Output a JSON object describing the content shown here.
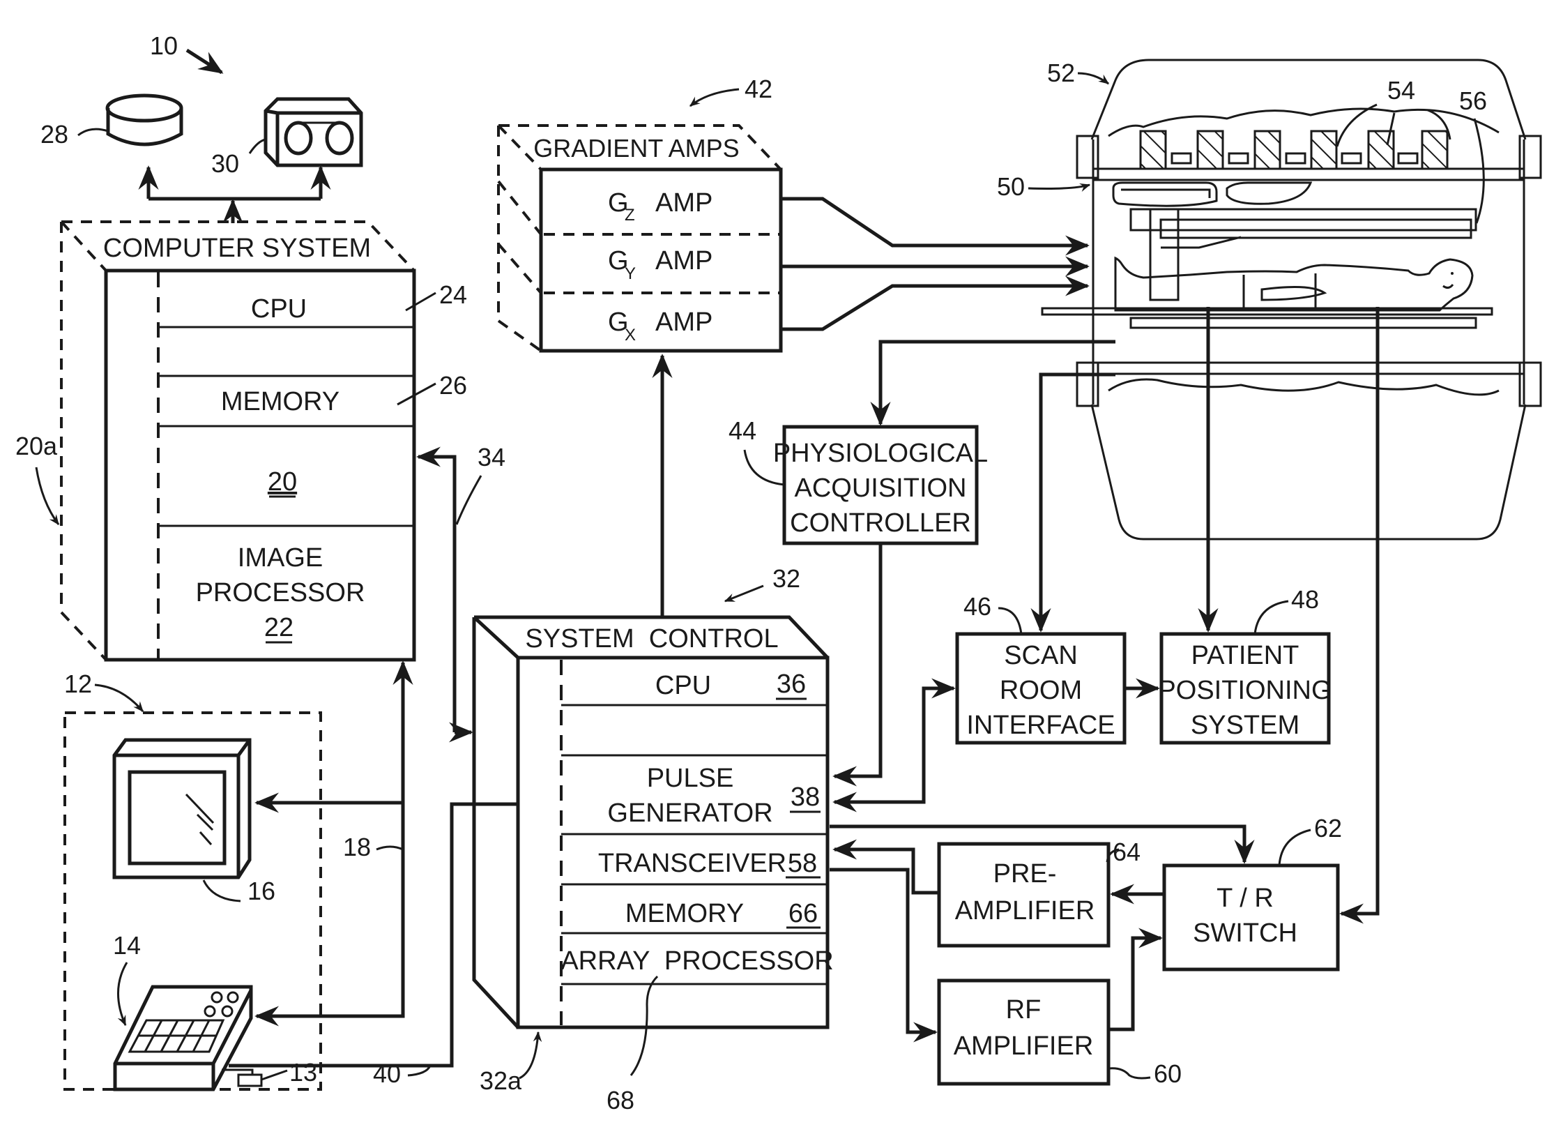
{
  "figure": {
    "system_ref": "10",
    "colors": {
      "ink": "#1a1a1a",
      "paper": "#ffffff"
    }
  },
  "storage": {
    "disk_ref": "28",
    "tape_ref": "30"
  },
  "computer_system": {
    "title": "COMPUTER SYSTEM",
    "housing_ref": "20a",
    "modules": [
      {
        "label": "CPU",
        "ref": "24"
      },
      {
        "label": "",
        "ref": ""
      },
      {
        "label": "MEMORY",
        "ref": "26"
      },
      {
        "label": "",
        "ref_underlined": "20"
      },
      {
        "label_lines": [
          "IMAGE",
          "PROCESSOR"
        ],
        "ref_underlined": "22"
      }
    ],
    "link_ref": "34"
  },
  "operator_console": {
    "ref": "12",
    "display_ref": "16",
    "control_panel_ref": "14",
    "input_device_ref": "13",
    "link_ref": "18",
    "console_link_ref": "40"
  },
  "gradient_amps": {
    "title": "GRADIENT AMPS",
    "ref": "42",
    "amps": [
      {
        "g": "G",
        "axis": "Z",
        "label": "AMP"
      },
      {
        "g": "G",
        "axis": "Y",
        "label": "AMP"
      },
      {
        "g": "G",
        "axis": "X",
        "label": "AMP"
      }
    ]
  },
  "system_control": {
    "title": "SYSTEM  CONTROL",
    "ref": "32",
    "housing_ref": "32a",
    "modules": [
      {
        "label": "CPU",
        "ref_underlined": "36"
      },
      {
        "label": ""
      },
      {
        "label_lines": [
          "PULSE",
          "GENERATOR"
        ],
        "ref_underlined": "38"
      },
      {
        "label": "TRANSCEIVER",
        "ref_underlined": "58"
      },
      {
        "label": "MEMORY",
        "ref_underlined": "66"
      },
      {
        "label": "ARRAY  PROCESSOR",
        "ref": "68"
      },
      {
        "label": ""
      }
    ]
  },
  "physiological_controller": {
    "lines": [
      "PHYSIOLOGICAL",
      "ACQUISITION",
      "CONTROLLER"
    ],
    "ref": "44"
  },
  "scan_room_interface": {
    "lines": [
      "SCAN",
      "ROOM",
      "INTERFACE"
    ],
    "ref": "46"
  },
  "patient_positioning": {
    "lines": [
      "PATIENT",
      "POSITIONING",
      "SYSTEM"
    ],
    "ref": "48"
  },
  "pre_amplifier": {
    "lines": [
      "PRE-",
      "AMPLIFIER"
    ],
    "ref": "64"
  },
  "rf_amplifier": {
    "lines": [
      "RF",
      "AMPLIFIER"
    ],
    "ref": "60"
  },
  "tr_switch": {
    "lines": [
      "T / R",
      "SWITCH"
    ],
    "ref": "62"
  },
  "magnet_assembly": {
    "assembly_ref": "52",
    "gradient_coil_ref": "50",
    "polarizing_magnet_ref": "54",
    "rf_coil_ref": "56"
  }
}
